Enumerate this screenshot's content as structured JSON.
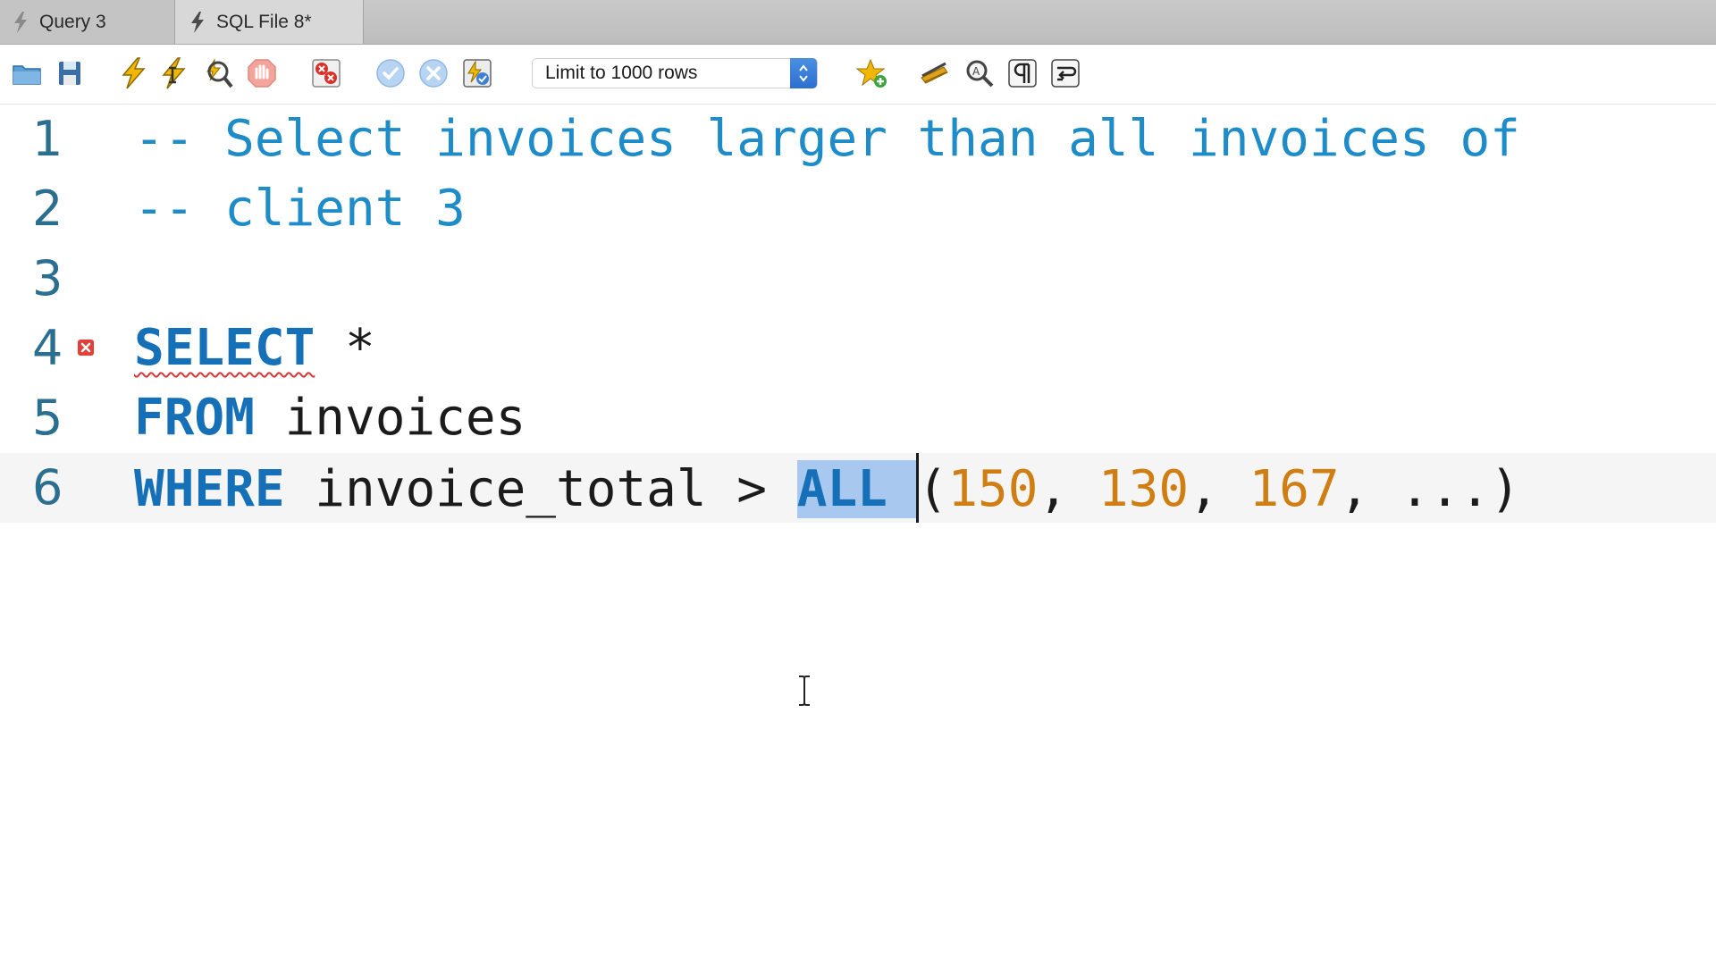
{
  "tabs": [
    {
      "label": "Query 3",
      "active": false
    },
    {
      "label": "SQL File 8*",
      "active": true
    }
  ],
  "toolbar": {
    "buttons": [
      {
        "icon": "open-folder-icon"
      },
      {
        "icon": "save-icon"
      },
      {
        "icon": "execute-lightning-icon"
      },
      {
        "icon": "execute-current-statement-icon"
      },
      {
        "icon": "explain-magnifier-icon"
      },
      {
        "icon": "stop-icon"
      },
      {
        "icon": "toggle-stop-on-error-icon"
      },
      {
        "icon": "commit-check-icon"
      },
      {
        "icon": "rollback-x-icon"
      },
      {
        "icon": "autocommit-toggle-icon"
      },
      {
        "icon": "add-snippet-star-icon"
      },
      {
        "icon": "beautify-broom-icon"
      },
      {
        "icon": "find-magnifier-icon"
      },
      {
        "icon": "invisible-chars-pilcrow-icon"
      },
      {
        "icon": "word-wrap-icon"
      }
    ],
    "limit_select": {
      "selected": "Limit to 1000 rows"
    }
  },
  "editor": {
    "lines": [
      {
        "number": "1",
        "text": "-- Select invoices larger than all invoices of"
      },
      {
        "number": "2",
        "text": "-- client 3"
      },
      {
        "number": "3",
        "text": ""
      },
      {
        "number": "4",
        "keyword": "SELECT",
        "rest": " *",
        "has_error": true
      },
      {
        "number": "5",
        "keyword": "FROM",
        "rest": " invoices"
      },
      {
        "number": "6",
        "keyword": "WHERE",
        "mid": " invoice_total > ",
        "selected": "ALL ",
        "open_paren": "(",
        "n1": "150",
        "sep1": ", ",
        "n2": "130",
        "sep2": ", ",
        "n3": "167",
        "tail": ", ...)",
        "current": true
      }
    ]
  },
  "colors": {
    "comment": "#1d8cc8",
    "keyword": "#1570b8",
    "number": "#d07e12",
    "line_number": "#2a6f8f",
    "selection": "#a9c8f0",
    "error": "#d23a3a"
  }
}
